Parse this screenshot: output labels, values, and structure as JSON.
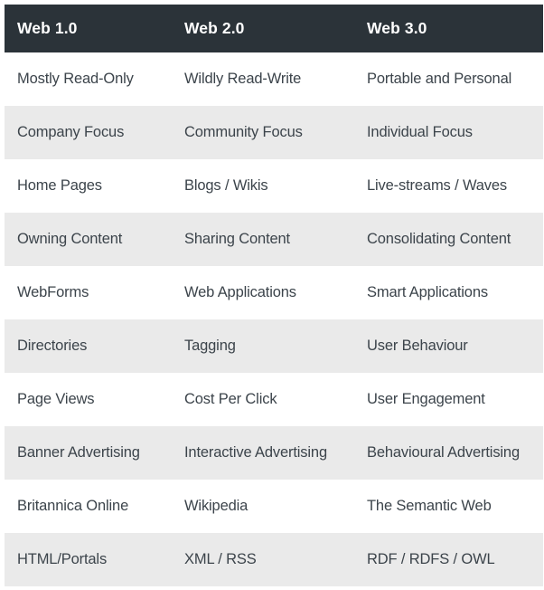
{
  "table": {
    "headers": [
      "Web 1.0",
      "Web 2.0",
      "Web 3.0"
    ],
    "rows": [
      [
        "Mostly Read-Only",
        "Wildly Read-Write",
        "Portable and Personal"
      ],
      [
        "Company Focus",
        "Community Focus",
        "Individual Focus"
      ],
      [
        "Home Pages",
        "Blogs / Wikis",
        "Live-streams / Waves"
      ],
      [
        "Owning Content",
        "Sharing Content",
        "Consolidating Content"
      ],
      [
        "WebForms",
        "Web Applications",
        "Smart Applications"
      ],
      [
        "Directories",
        "Tagging",
        "User Behaviour"
      ],
      [
        "Page Views",
        "Cost Per Click",
        "User Engagement"
      ],
      [
        "Banner Advertising",
        "Interactive Advertising",
        "Behavioural Advertising"
      ],
      [
        "Britannica Online",
        "Wikipedia",
        "The Semantic Web"
      ],
      [
        "HTML/Portals",
        "XML / RSS",
        "RDF / RDFS / OWL"
      ]
    ]
  },
  "colors": {
    "header_background": "#2b3339",
    "header_text": "#ffffff",
    "body_text": "#3c444b",
    "row_odd_background": "#ffffff",
    "row_even_background": "#eaeaea",
    "page_background": "#ffffff"
  }
}
